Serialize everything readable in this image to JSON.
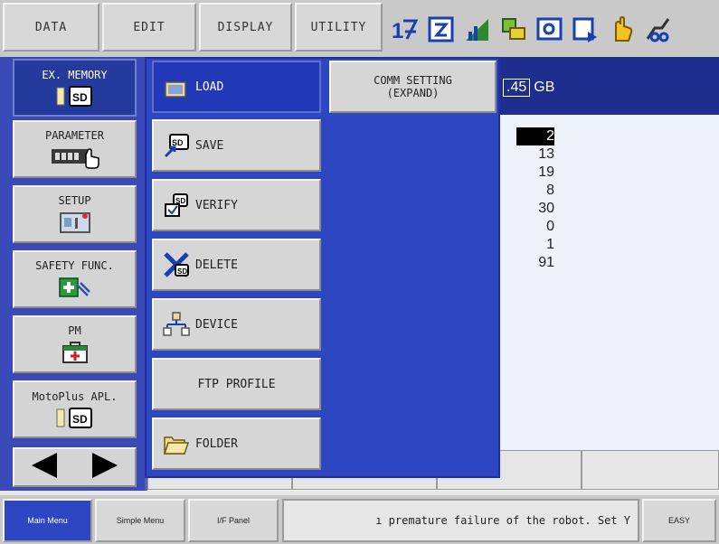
{
  "top_menu": {
    "data": "DATA",
    "edit": "EDIT",
    "display": "DISPLAY",
    "utility": "UTILITY"
  },
  "status_icons": [
    "coordinate-icon",
    "edit-mode-icon",
    "signal-icon",
    "job-icon",
    "monitor-icon",
    "play-mode-icon",
    "hand-icon",
    "servo-icon"
  ],
  "side_menu": {
    "ex_memory": "EX. MEMORY",
    "parameter": "PARAMETER",
    "setup": "SETUP",
    "safety": "SAFETY FUNC.",
    "pm": "PM",
    "motoplus": "MotoPlus APL."
  },
  "submenu": {
    "load": "LOAD",
    "save": "SAVE",
    "verify": "VERIFY",
    "delete": "DELETE",
    "device": "DEVICE",
    "ftp": "FTP PROFILE",
    "folder": "FOLDER",
    "comm_line1": "COMM SETTING",
    "comm_line2": "(EXPAND)"
  },
  "content": {
    "gb_value": ".45",
    "gb_unit": "GB",
    "numbers": [
      "2",
      "13",
      "19",
      "8",
      "30",
      "0",
      "1",
      "91"
    ]
  },
  "bottom": {
    "main_menu": "Main Menu",
    "simple_menu": "Simple Menu",
    "if_panel": "I/F Panel",
    "message": "ı premature failure of the robot. Set Y",
    "easy": "EASY"
  },
  "colors": {
    "accent_blue": "#2d46c2",
    "header_blue": "#1e2e8e",
    "button_gray": "#d6d6d6"
  }
}
